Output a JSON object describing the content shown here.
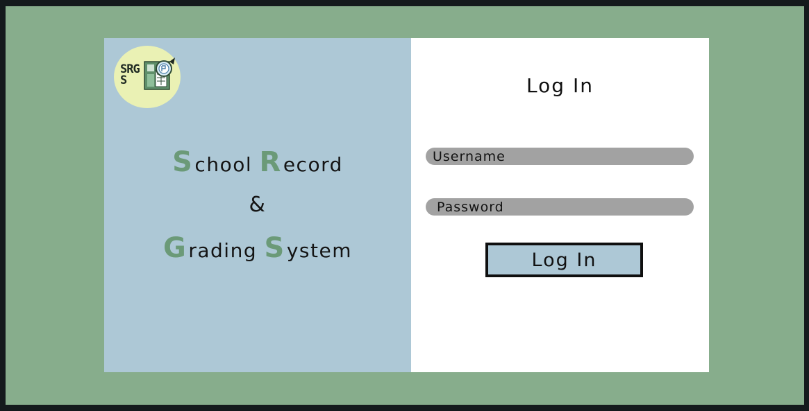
{
  "logo": {
    "text": "SRGS"
  },
  "app_title": {
    "line1": [
      {
        "cap": "S",
        "rest": "chool "
      },
      {
        "cap": "R",
        "rest": "ecord"
      }
    ],
    "line2": "&",
    "line3": [
      {
        "cap": "G",
        "rest": "rading "
      },
      {
        "cap": "S",
        "rest": "ystem"
      }
    ]
  },
  "login": {
    "title": "Log In",
    "username_placeholder": "Username",
    "password_placeholder": "Password",
    "button_label": "Log In"
  },
  "colors": {
    "background": "#87ad8c",
    "left_panel": "#adc8d6",
    "accent_letters": "#6b9a78",
    "input_fill": "#a2a2a2",
    "logo_circle": "#eaf1b4"
  }
}
